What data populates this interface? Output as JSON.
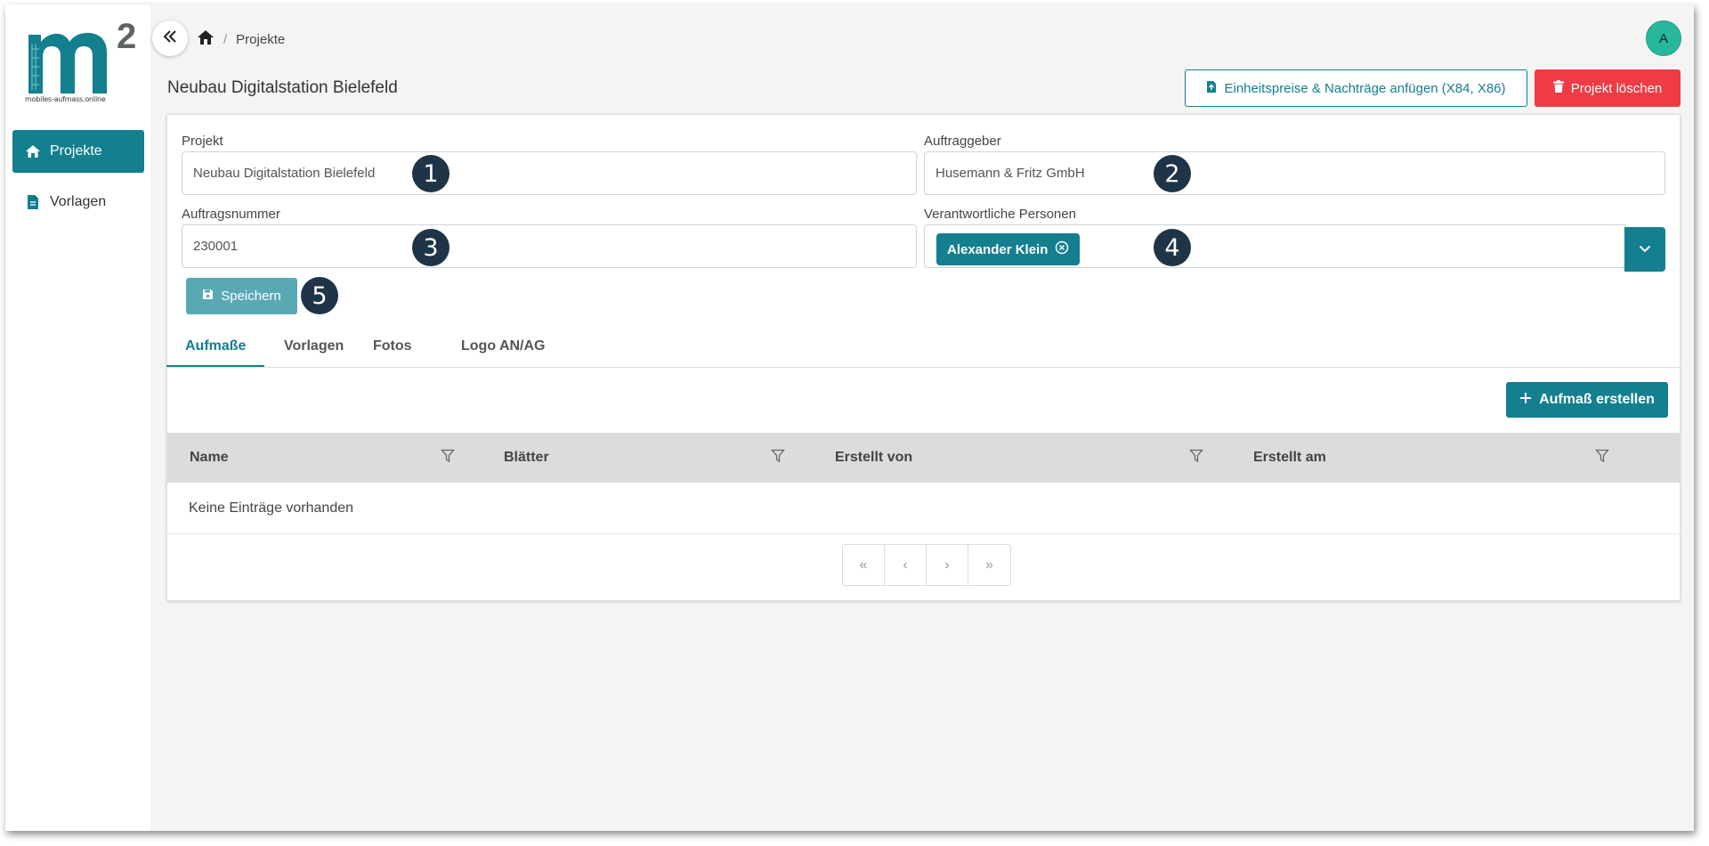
{
  "sidebar": {
    "logo_letter": "m",
    "logo_superscript": "2",
    "logo_text": "mobiles-aufmass.online",
    "items": [
      {
        "label": "Projekte",
        "icon": "home-icon",
        "active": true
      },
      {
        "label": "Vorlagen",
        "icon": "document-icon",
        "active": false
      }
    ]
  },
  "topbar": {
    "breadcrumb": [
      "Projekte"
    ],
    "avatar_initial": "A"
  },
  "header": {
    "title": "Neubau Digitalstation Bielefeld",
    "prices_button": "Einheitspreise & Nachträge anfügen (X84, X86)",
    "delete_button": "Projekt löschen"
  },
  "form": {
    "project_label": "Projekt",
    "project_value": "Neubau Digitalstation Bielefeld",
    "client_label": "Auftraggeber",
    "client_value": "Husemann & Fritz GmbH",
    "order_label": "Auftragsnummer",
    "order_value": "230001",
    "persons_label": "Verantwortliche Personen",
    "persons": [
      "Alexander Klein"
    ],
    "save_button": "Speichern"
  },
  "callouts": [
    "1",
    "2",
    "3",
    "4",
    "5"
  ],
  "tabs": [
    "Aufmaße",
    "Vorlagen",
    "Fotos",
    "Logo AN/AG"
  ],
  "active_tab": 0,
  "create_button": "Aufmaß erstellen",
  "table": {
    "columns": [
      "Name",
      "Blätter",
      "Erstellt von",
      "Erstellt am"
    ],
    "empty_text": "Keine Einträge vorhanden"
  },
  "pager": [
    "«",
    "‹",
    "›",
    "»"
  ],
  "colors": {
    "accent": "#137f8f",
    "danger": "#ef3b43",
    "avatar": "#27b89b",
    "callout": "#1f3447"
  }
}
